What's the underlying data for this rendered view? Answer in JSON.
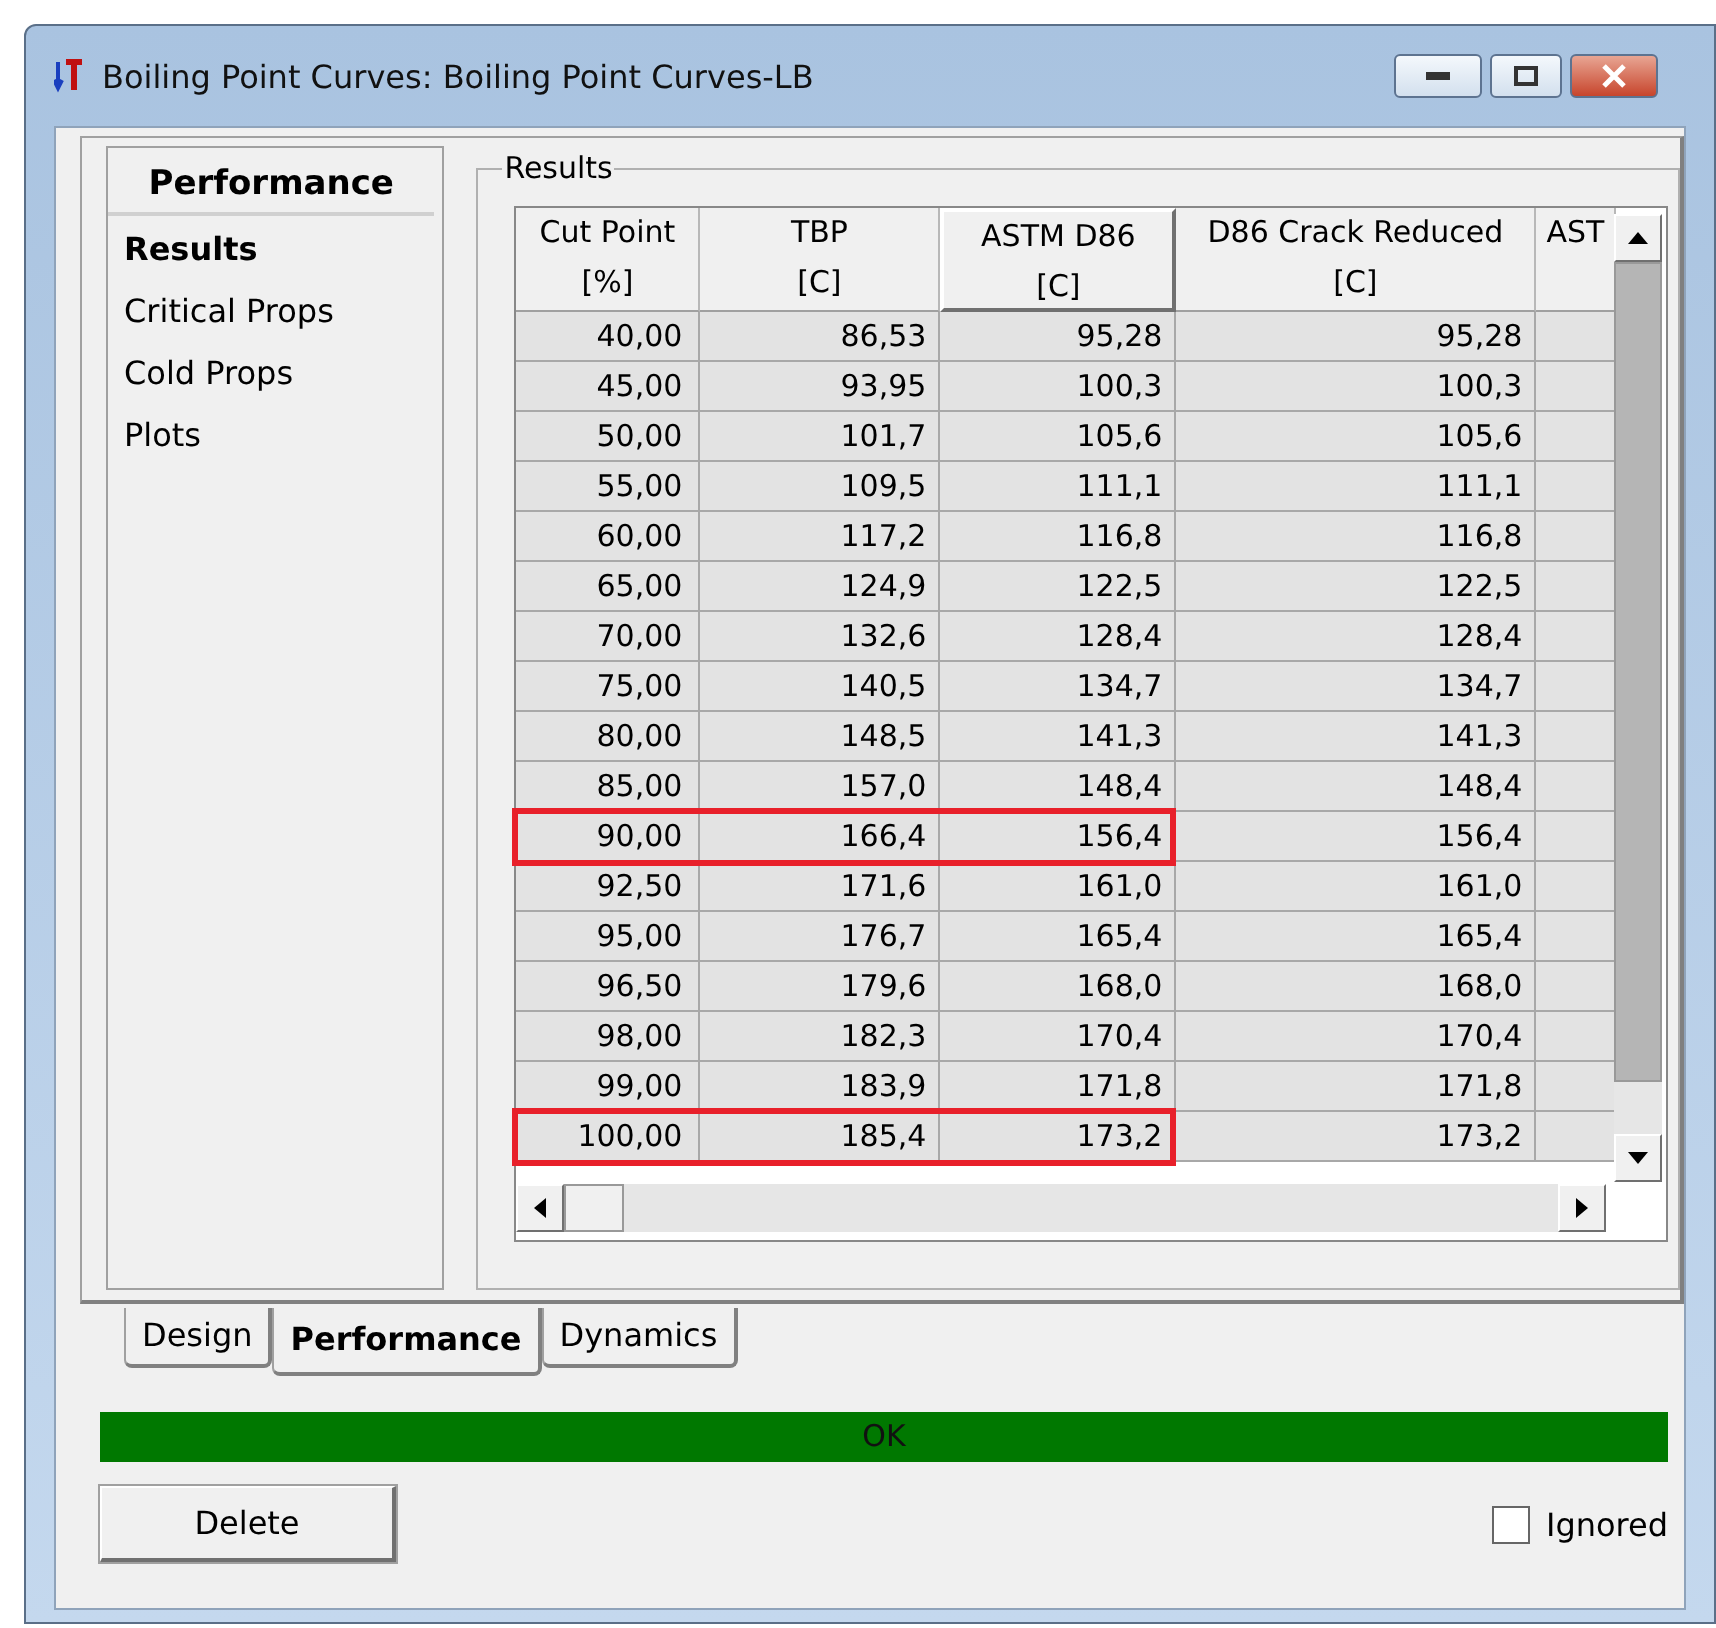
{
  "window": {
    "title": "Boiling Point Curves: Boiling Point Curves-LB"
  },
  "sidebar": {
    "title": "Performance",
    "items": [
      {
        "label": "Results",
        "selected": true
      },
      {
        "label": "Critical Props",
        "selected": false
      },
      {
        "label": "Cold Props",
        "selected": false
      },
      {
        "label": "Plots",
        "selected": false
      }
    ]
  },
  "results": {
    "title": "Results",
    "columns": [
      {
        "name": "Cut Point",
        "unit": "[%]",
        "pressed": false
      },
      {
        "name": "TBP",
        "unit": "[C]",
        "pressed": false
      },
      {
        "name": "ASTM D86",
        "unit": "[C]",
        "pressed": true
      },
      {
        "name": "D86 Crack Reduced",
        "unit": "[C]",
        "pressed": false
      },
      {
        "name": "AST",
        "pressed": false
      }
    ],
    "rows": [
      {
        "cells": [
          "40,00",
          "86,53",
          "95,28",
          "95,28"
        ],
        "highlighted": false
      },
      {
        "cells": [
          "45,00",
          "93,95",
          "100,3",
          "100,3"
        ],
        "highlighted": false
      },
      {
        "cells": [
          "50,00",
          "101,7",
          "105,6",
          "105,6"
        ],
        "highlighted": false
      },
      {
        "cells": [
          "55,00",
          "109,5",
          "111,1",
          "111,1"
        ],
        "highlighted": false
      },
      {
        "cells": [
          "60,00",
          "117,2",
          "116,8",
          "116,8"
        ],
        "highlighted": false
      },
      {
        "cells": [
          "65,00",
          "124,9",
          "122,5",
          "122,5"
        ],
        "highlighted": false
      },
      {
        "cells": [
          "70,00",
          "132,6",
          "128,4",
          "128,4"
        ],
        "highlighted": false
      },
      {
        "cells": [
          "75,00",
          "140,5",
          "134,7",
          "134,7"
        ],
        "highlighted": false
      },
      {
        "cells": [
          "80,00",
          "148,5",
          "141,3",
          "141,3"
        ],
        "highlighted": false
      },
      {
        "cells": [
          "85,00",
          "157,0",
          "148,4",
          "148,4"
        ],
        "highlighted": false
      },
      {
        "cells": [
          "90,00",
          "166,4",
          "156,4",
          "156,4"
        ],
        "highlighted": true
      },
      {
        "cells": [
          "92,50",
          "171,6",
          "161,0",
          "161,0"
        ],
        "highlighted": false
      },
      {
        "cells": [
          "95,00",
          "176,7",
          "165,4",
          "165,4"
        ],
        "highlighted": false
      },
      {
        "cells": [
          "96,50",
          "179,6",
          "168,0",
          "168,0"
        ],
        "highlighted": false
      },
      {
        "cells": [
          "98,00",
          "182,3",
          "170,4",
          "170,4"
        ],
        "highlighted": false
      },
      {
        "cells": [
          "99,00",
          "183,9",
          "171,8",
          "171,8"
        ],
        "highlighted": false
      },
      {
        "cells": [
          "100,00",
          "185,4",
          "173,2",
          "173,2"
        ],
        "highlighted": true
      }
    ]
  },
  "tabs": [
    {
      "label": "Design",
      "selected": false
    },
    {
      "label": "Performance",
      "selected": true
    },
    {
      "label": "Dynamics",
      "selected": false
    }
  ],
  "status": {
    "text": "OK"
  },
  "buttons": [
    {
      "label": "Delete"
    }
  ],
  "ignored": {
    "label": "Ignored",
    "checked": false
  }
}
